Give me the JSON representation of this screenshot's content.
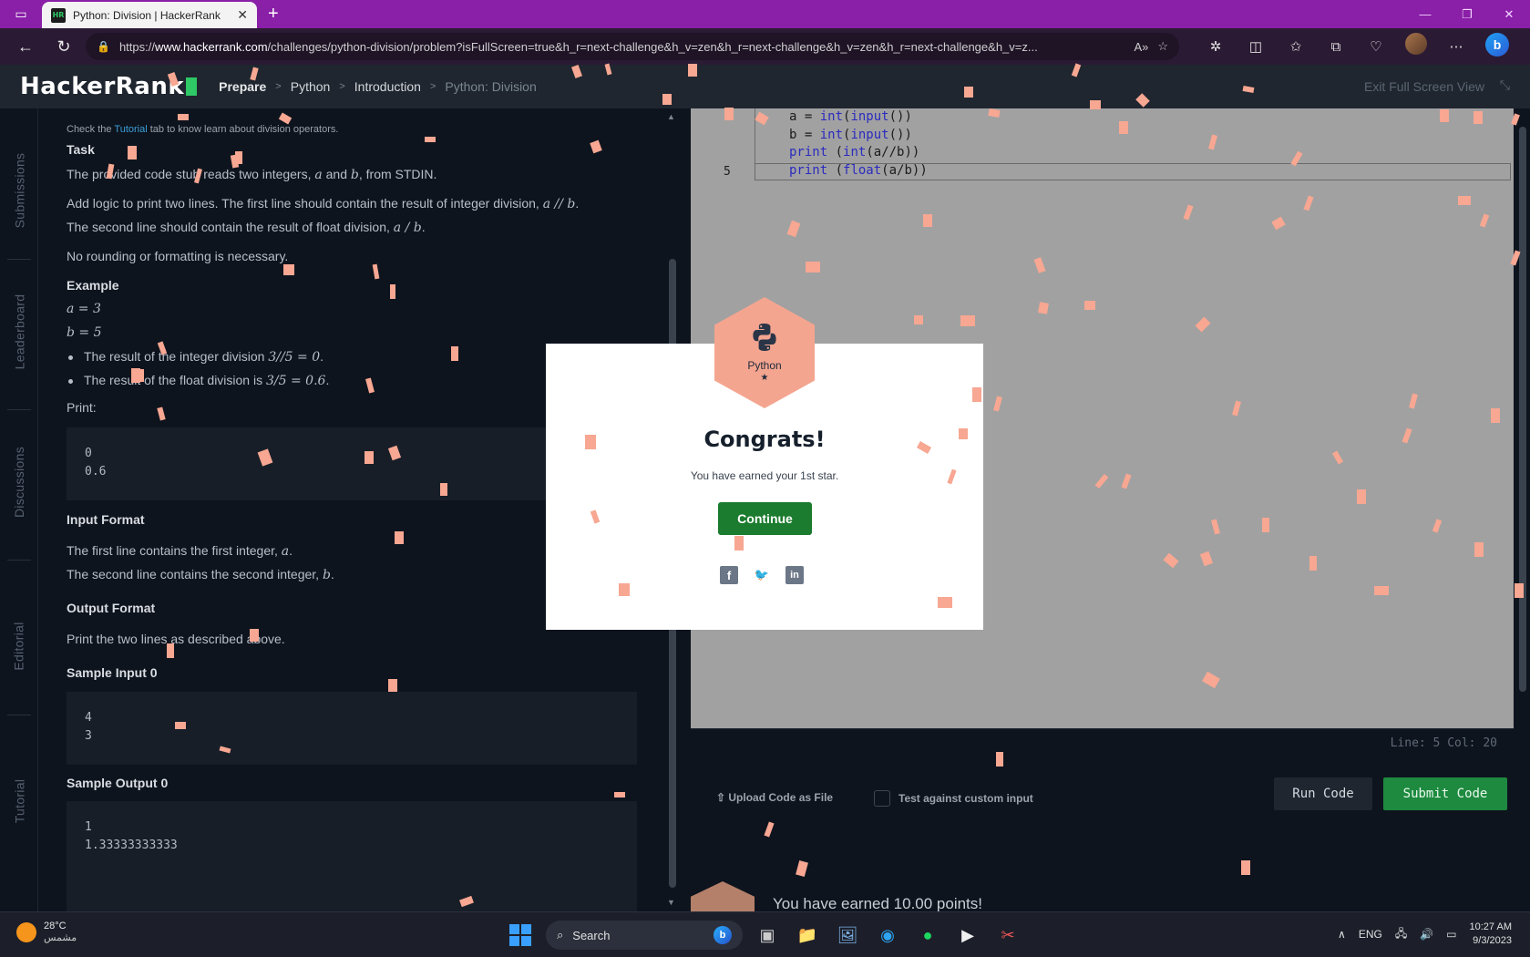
{
  "browser": {
    "tab_title": "Python: Division | HackerRank",
    "url_prefix": "https://",
    "url_host": "www.hackerrank.com",
    "url_path": "/challenges/python-division/problem?isFullScreen=true&h_r=next-challenge&h_v=zen&h_r=next-challenge&h_v=zen&h_r=next-challenge&h_v=z..."
  },
  "header": {
    "logo": "HackerRank",
    "breadcrumbs": [
      "Prepare",
      "Python",
      "Introduction",
      "Python: Division"
    ],
    "exit_full_screen": "Exit Full Screen View"
  },
  "vtabs": [
    "Submissions",
    "Leaderboard",
    "Discussions",
    "Editorial",
    "Tutorial"
  ],
  "problem": {
    "note_pre": "Check the ",
    "note_link": "Tutorial",
    "note_post": " tab to know learn about division operators.",
    "task_heading": "Task",
    "task_line1_pre": "The provided code stub reads two integers, ",
    "task_line1_a": "a",
    "task_line1_mid": " and ",
    "task_line1_b": "b",
    "task_line1_post": ", from STDIN.",
    "task_line2_pre": "Add logic to print two lines. The first line should contain the result of integer division, ",
    "task_line2_math": "a // b",
    "task_line2_post": ".",
    "task_line3_pre": "The second line should contain the result of float division, ",
    "task_line3_math": "a / b",
    "task_line3_post": ".",
    "task_line4": "No rounding or formatting is necessary.",
    "example_heading": "Example",
    "example_a": "a = 3",
    "example_b": "b = 5",
    "bullet1_pre": "The result of the integer division ",
    "bullet1_math": "3//5 = 0",
    "bullet1_post": ".",
    "bullet2_pre": "The result of the float division is ",
    "bullet2_math": "3/5 = 0.6",
    "bullet2_post": ".",
    "print_label": "Print:",
    "print_out": [
      "0",
      "0.6"
    ],
    "input_format_heading": "Input Format",
    "input_line1_pre": "The first line contains the first integer, ",
    "input_line1_math": "a",
    "input_line1_post": ".",
    "input_line2_pre": "The second line contains the second integer, ",
    "input_line2_math": "b",
    "input_line2_post": ".",
    "output_format_heading": "Output Format",
    "output_line": "Print the two lines as described above.",
    "sample_input_heading": "Sample Input 0",
    "sample_input": [
      "4",
      "3"
    ],
    "sample_output_heading": "Sample Output 0",
    "sample_output": [
      "1",
      "1.33333333333"
    ]
  },
  "editor": {
    "lines": [
      {
        "num": "",
        "parts": [
          [
            "a = ",
            ""
          ],
          [
            "int",
            "kw"
          ],
          [
            "(",
            ""
          ],
          [
            "input",
            "kw"
          ],
          [
            "())",
            ""
          ]
        ]
      },
      {
        "num": "",
        "parts": [
          [
            "b = ",
            ""
          ],
          [
            "int",
            "kw"
          ],
          [
            "(",
            ""
          ],
          [
            "input",
            "kw"
          ],
          [
            "())",
            ""
          ]
        ]
      },
      {
        "num": "",
        "parts": [
          [
            "print",
            "kw"
          ],
          [
            " (",
            ""
          ],
          [
            "int",
            "kw"
          ],
          [
            "(a//b))",
            ""
          ]
        ]
      },
      {
        "num": "5",
        "parts": [
          [
            "print",
            "kw"
          ],
          [
            " (",
            ""
          ],
          [
            "float",
            "kw"
          ],
          [
            "(a/b))",
            ""
          ]
        ]
      }
    ],
    "status": "Line: 5 Col: 20"
  },
  "actions": {
    "upload_label": "Upload Code as File",
    "custom_input_label": "Test against custom input",
    "run_label": "Run Code",
    "submit_label": "Submit Code",
    "earned_points": "You have earned 10.00 points!"
  },
  "modal": {
    "badge_label": "Python",
    "badge_star": "★",
    "title": "Congrats!",
    "message": "You have earned your 1st star.",
    "continue_label": "Continue"
  },
  "taskbar": {
    "temp": "28°C",
    "weather": "مشمس",
    "search_label": "Search",
    "lang": "ENG",
    "time": "10:27 AM",
    "date": "9/3/2023"
  },
  "colors": {
    "browser_tab_bar": "#8a1fa8",
    "hr_header": "#1f262f",
    "page_bg": "#0e141e",
    "editor_bg": "#a1a1a1",
    "submit": "#1d8a3f",
    "continue": "#1b7b2e",
    "badge": "#f4a590",
    "confetti": "#f7a792"
  }
}
